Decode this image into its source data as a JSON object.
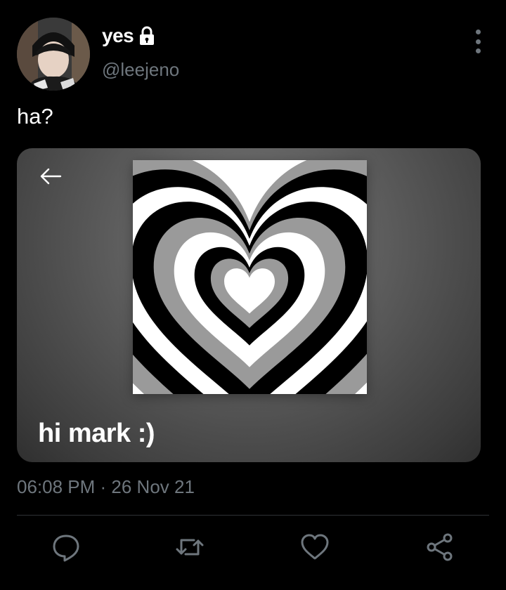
{
  "user": {
    "display_name": "yes",
    "handle": "@leejeno",
    "verified_lock": "lock-icon",
    "avatar": "avatar"
  },
  "tweet": {
    "text": "ha?",
    "timestamp": "06:08 PM · 26 Nov 21"
  },
  "media": {
    "caption": "hi mark :)",
    "image": "concentric-heart-image"
  },
  "actions": [
    {
      "name": "reply",
      "icon": "speech-bubble-icon"
    },
    {
      "name": "retweet",
      "icon": "retweet-icon"
    },
    {
      "name": "like",
      "icon": "heart-icon"
    },
    {
      "name": "share",
      "icon": "share-icon"
    }
  ],
  "colors": {
    "background": "#000000",
    "text": "#ffffff",
    "secondary_text": "#6e767d",
    "divider": "#2f3336"
  }
}
